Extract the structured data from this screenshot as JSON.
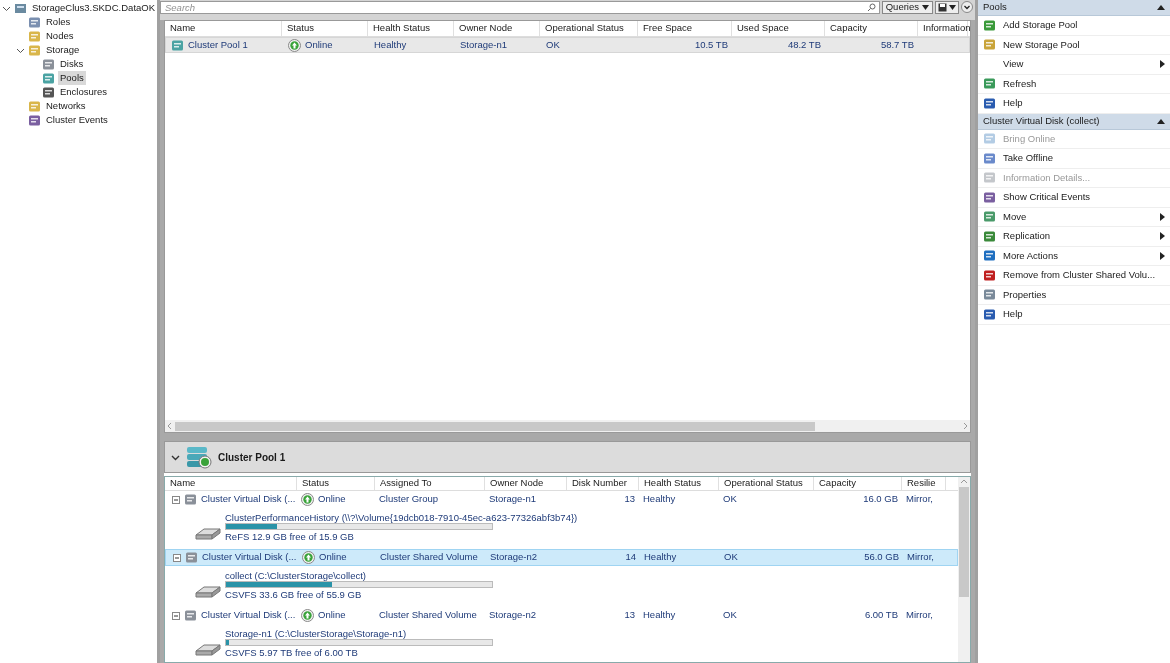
{
  "tree": {
    "label": "StorageClus3.SKDC.DataOK",
    "expanded": true,
    "children": [
      {
        "label": "Roles",
        "selected": false
      },
      {
        "label": "Nodes",
        "selected": false
      },
      {
        "label": "Storage",
        "selected": false,
        "expanded": true,
        "children": [
          {
            "label": "Disks",
            "selected": false
          },
          {
            "label": "Pools",
            "selected": true
          },
          {
            "label": "Enclosures",
            "selected": false
          }
        ]
      },
      {
        "label": "Networks",
        "selected": false
      },
      {
        "label": "Cluster Events",
        "selected": false
      }
    ]
  },
  "search": {
    "placeholder": "Search"
  },
  "toolbar": {
    "queries": "Queries"
  },
  "pools_table": {
    "columns": [
      "Name",
      "Status",
      "Health Status",
      "Owner Node",
      "Operational Status",
      "Free Space",
      "Used Space",
      "Capacity",
      "Information"
    ],
    "rows": [
      {
        "selected": true,
        "cells": [
          "Cluster Pool 1",
          "Online",
          "Healthy",
          "Storage-n1",
          "OK",
          "10.5 TB",
          "48.2 TB",
          "58.7 TB"
        ]
      }
    ]
  },
  "detail": {
    "title": "Cluster Pool 1",
    "expanded": true,
    "columns": [
      "Name",
      "Status",
      "Assigned To",
      "Owner Node",
      "Disk Number",
      "Health Status",
      "Operational Status",
      "Capacity",
      "Resilie"
    ],
    "rows": [
      {
        "selected": false,
        "expanded": true,
        "cells": [
          "Cluster Virtual Disk (...",
          "Online",
          "Cluster Group",
          "Storage-n1",
          "13",
          "Healthy",
          "OK",
          "16.0 GB",
          "Mirror,"
        ],
        "volume": {
          "name": "ClusterPerformanceHistory (\\\\?\\Volume{19dcb018-7910-45ec-a623-77326abf3b74})",
          "level": 0.19,
          "usage": "ReFS 12.9 GB free of 15.9 GB"
        }
      },
      {
        "selected": true,
        "expanded": true,
        "cells": [
          "Cluster Virtual Disk (...",
          "Online",
          "Cluster Shared Volume",
          "Storage-n2",
          "14",
          "Healthy",
          "OK",
          "56.0 GB",
          "Mirror,"
        ],
        "volume": {
          "name": "collect (C:\\ClusterStorage\\collect)",
          "level": 0.4,
          "usage": "CSVFS 33.6 GB free of 55.9 GB"
        }
      },
      {
        "selected": false,
        "expanded": true,
        "cells": [
          "Cluster Virtual Disk (...",
          "Online",
          "Cluster Shared Volume",
          "Storage-n2",
          "13",
          "Healthy",
          "OK",
          "6.00 TB",
          "Mirror,"
        ],
        "volume": {
          "name": "Storage-n1 (C:\\ClusterStorage\\Storage-n1)",
          "level": 0.01,
          "usage": "CSVFS 5.97 TB free of 6.00 TB"
        }
      }
    ]
  },
  "actions": [
    {
      "title": "Pools",
      "expanded": true,
      "items": [
        {
          "label": "Add Storage Pool",
          "disabled": false,
          "submenu": false
        },
        {
          "label": "New Storage Pool",
          "disabled": false,
          "submenu": false
        },
        {
          "label": "View",
          "disabled": false,
          "submenu": true
        },
        {
          "label": "Refresh",
          "disabled": false,
          "submenu": false
        },
        {
          "label": "Help",
          "disabled": false,
          "submenu": false
        }
      ]
    },
    {
      "title": "Cluster Virtual Disk (collect)",
      "expanded": true,
      "items": [
        {
          "label": "Bring Online",
          "disabled": true,
          "submenu": false
        },
        {
          "label": "Take Offline",
          "disabled": false,
          "submenu": false
        },
        {
          "label": "Information Details...",
          "disabled": true,
          "submenu": false
        },
        {
          "label": "Show Critical Events",
          "disabled": false,
          "submenu": false
        },
        {
          "label": "Move",
          "disabled": false,
          "submenu": true
        },
        {
          "label": "Replication",
          "disabled": false,
          "submenu": true
        },
        {
          "label": "More Actions",
          "disabled": false,
          "submenu": true
        },
        {
          "label": "Remove from Cluster Shared Volu...",
          "disabled": false,
          "submenu": false
        },
        {
          "label": "Properties",
          "disabled": false,
          "submenu": false
        },
        {
          "label": "Help",
          "disabled": false,
          "submenu": false
        }
      ]
    }
  ]
}
